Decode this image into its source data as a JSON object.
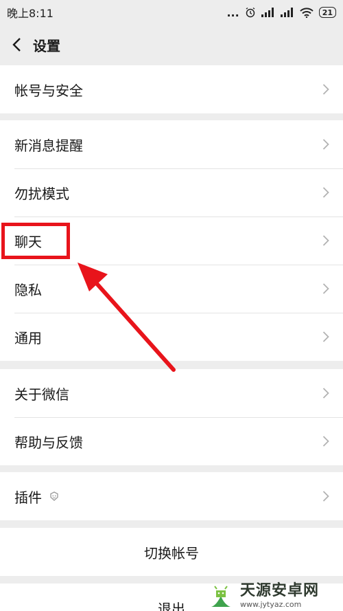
{
  "status_bar": {
    "time": "晚上8:11",
    "dots": "...",
    "battery": "21"
  },
  "nav": {
    "title": "设置"
  },
  "groups": [
    {
      "items": [
        {
          "label": "帐号与安全"
        }
      ]
    },
    {
      "items": [
        {
          "label": "新消息提醒"
        },
        {
          "label": "勿扰模式"
        },
        {
          "label": "聊天"
        },
        {
          "label": "隐私"
        },
        {
          "label": "通用"
        }
      ]
    },
    {
      "items": [
        {
          "label": "关于微信"
        },
        {
          "label": "帮助与反馈"
        }
      ]
    },
    {
      "items": [
        {
          "label": "插件"
        }
      ]
    }
  ],
  "actions": {
    "switch_account": "切换帐号",
    "logout": "退出"
  },
  "watermark": {
    "title": "天源安卓网",
    "url": "www.jytyaz.com"
  },
  "colors": {
    "background": "#ededed",
    "highlight": "#e8141b",
    "text": "#1a1a1a"
  }
}
